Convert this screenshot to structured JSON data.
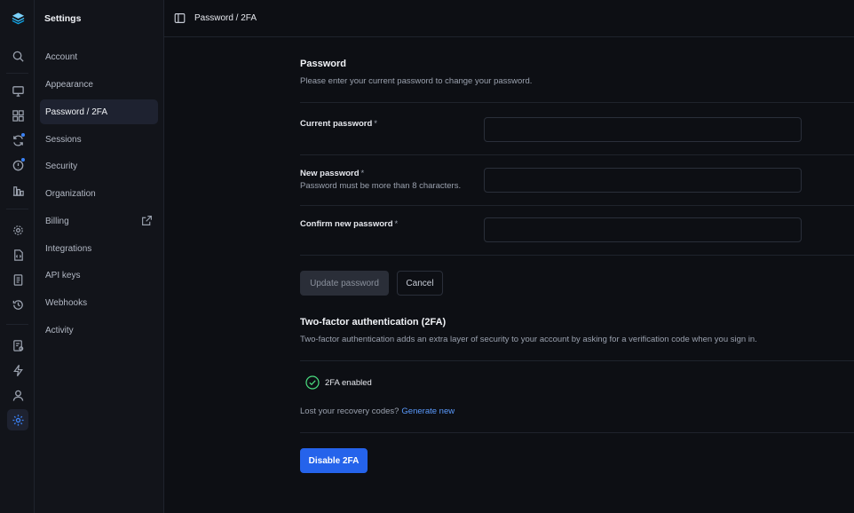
{
  "sidebar": {
    "title": "Settings",
    "items": [
      {
        "label": "Account"
      },
      {
        "label": "Appearance"
      },
      {
        "label": "Password / 2FA",
        "active": true
      },
      {
        "label": "Sessions"
      },
      {
        "label": "Security"
      },
      {
        "label": "Organization"
      },
      {
        "label": "Billing",
        "icon": "external-link-icon"
      },
      {
        "label": "Integrations"
      },
      {
        "label": "API keys"
      },
      {
        "label": "Webhooks"
      },
      {
        "label": "Activity"
      }
    ]
  },
  "rail": {
    "icons": [
      "logo-layers-icon",
      "search-icon",
      "monitor-icon",
      "grid-icon",
      "sync-icon",
      "alert-icon",
      "chart-icon",
      "cog-icon",
      "code-file-icon",
      "document-icon",
      "history-icon",
      "report-icon",
      "lightning-icon",
      "user-icon",
      "settings-icon"
    ],
    "accent": "#3b82f6"
  },
  "topbar": {
    "breadcrumb": "Password / 2FA"
  },
  "password": {
    "title": "Password",
    "description": "Please enter your current password to change your password.",
    "fields": [
      {
        "label": "Current password",
        "required": "*",
        "hint": "",
        "value": ""
      },
      {
        "label": "New password",
        "required": "*",
        "hint": "Password must be more than 8 characters.",
        "value": ""
      },
      {
        "label": "Confirm new password",
        "required": "*",
        "hint": "",
        "value": ""
      }
    ],
    "update_label": "Update password",
    "cancel_label": "Cancel"
  },
  "twofa": {
    "title": "Two-factor authentication (2FA)",
    "description": "Two-factor authentication adds an extra layer of security to your account by asking for a verification code when you sign in.",
    "status": "2FA enabled",
    "recovery_text": "Lost your recovery codes?",
    "recovery_link": "Generate new",
    "disable_label": "Disable 2FA"
  },
  "colors": {
    "primary": "#2563eb",
    "link": "#5b9bff",
    "success": "#4ade80",
    "background": "#0d0f14"
  }
}
